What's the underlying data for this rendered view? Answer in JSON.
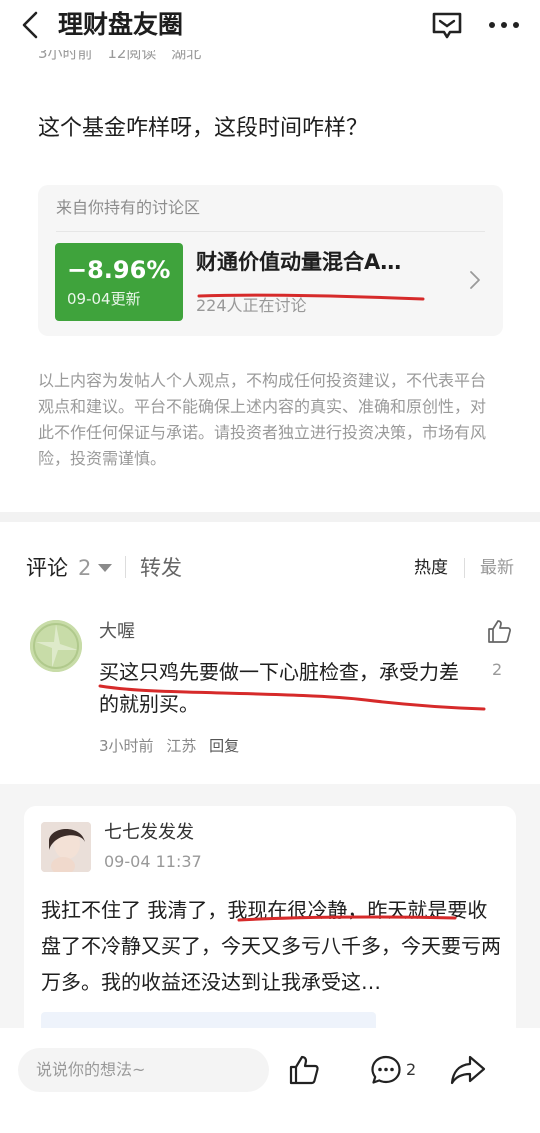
{
  "header": {
    "title": "理财盘友圈",
    "back_icon": "chevron-left-icon",
    "message_icon": "chat-square-icon",
    "more_icon": "more-dots-icon"
  },
  "post": {
    "meta": [
      "3小时前",
      "12阅读",
      "湖北"
    ],
    "text": "这个基金咋样呀，这段时间咋样？",
    "fund_card": {
      "source": "来自你持有的讨论区",
      "change": "−8.96%",
      "update_date": "09-04更新",
      "name": "财通价值动量混合A…",
      "discussing": "224人正在讨论",
      "badge_color": "#3fa33c"
    },
    "disclaimer": "以上内容为发帖人个人观点，不构成任何投资建议，不代表平台观点和建议。平台不能确保上述内容的真实、准确和原创性，对此不作任何保证与承诺。请投资者独立进行投资决策，市场有风险，投资需谨慎。"
  },
  "comment_tabs": {
    "comment_label": "评论",
    "comment_count": "2",
    "forward_label": "转发",
    "sort_hot": "热度",
    "sort_new": "最新"
  },
  "comments": [
    {
      "name": "大喔",
      "text": "买这只鸡先要做一下心脏检查，承受力差的就别买。",
      "time": "3小时前",
      "location": "江苏",
      "reply_label": "回复",
      "likes": "2"
    }
  ],
  "repost": {
    "name": "七七发发发",
    "time": "09-04 11:37",
    "text": "我扛不住了 我清了，我现在很冷静，昨天就是要收盘了不冷静又买了，今天又多亏八千多，今天要亏两万多。我的收益还没达到让我承受这…"
  },
  "bottom_bar": {
    "input_placeholder": "说说你的想法~",
    "comment_count": "2"
  },
  "colors": {
    "annotation_red": "#d62a2a",
    "gain_loss_green": "#3fa33c"
  }
}
